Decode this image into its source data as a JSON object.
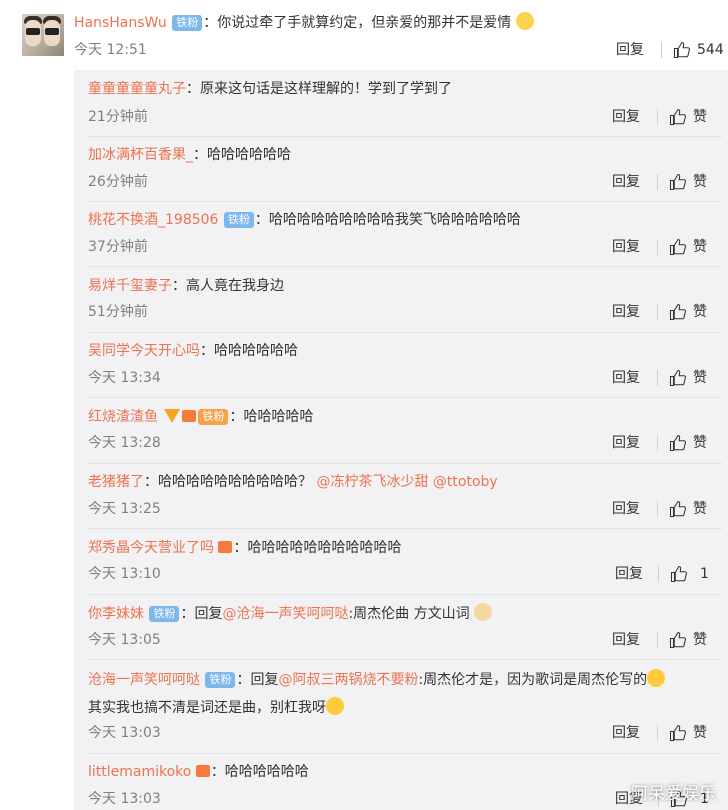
{
  "main_comment": {
    "user": "HansHansWu",
    "badge": "铁粉",
    "colon": "：",
    "text": "你说过牵了手就算约定，但亲爱的那并不是爱情",
    "time": "今天 12:51",
    "reply_label": "回复",
    "like_count": "544"
  },
  "replies": [
    {
      "user": "童童童童童丸子",
      "badge": "",
      "prefix": "",
      "mention": "",
      "text": "：原来这句话是这样理解的！学到了学到了",
      "time": "21分钟前",
      "reply_label": "回复",
      "like_label": "赞"
    },
    {
      "user": "加冰满杯百香果_",
      "badge": "",
      "text": "：哈哈哈哈哈哈",
      "time": "26分钟前",
      "reply_label": "回复",
      "like_label": "赞"
    },
    {
      "user": "桃花不换酒_198506",
      "badge": "铁粉",
      "text": "：哈哈哈哈哈哈哈哈哈我笑飞哈哈哈哈哈哈",
      "time": "37分钟前",
      "reply_label": "回复",
      "like_label": "赞"
    },
    {
      "user": "易烊千玺妻子",
      "badge": "",
      "text": "：高人竟在我身边",
      "time": "51分钟前",
      "reply_label": "回复",
      "like_label": "赞"
    },
    {
      "user": "吴同学今天开心吗",
      "badge": "",
      "text": "：哈哈哈哈哈哈",
      "time": "今天 13:34",
      "reply_label": "回复",
      "like_label": "赞"
    },
    {
      "user": "红烧渣渣鱼",
      "badge": "铁粉",
      "text": "：哈哈哈哈哈",
      "time": "今天 13:28",
      "reply_label": "回复",
      "like_label": "赞"
    },
    {
      "user": "老猪猪了",
      "badge": "",
      "text": "：哈哈哈哈哈哈哈哈哈哈？",
      "mention1": "@冻柠茶飞冰少甜",
      "mention2": "@ttotoby",
      "time": "今天 13:25",
      "reply_label": "回复",
      "like_label": "赞"
    },
    {
      "user": "郑秀晶今天营业了吗",
      "badge": "",
      "text": "：哈哈哈哈哈哈哈哈哈哈哈",
      "time": "今天 13:10",
      "reply_label": "回复",
      "like_count": "1"
    },
    {
      "user": "你李妹妹",
      "badge": "铁粉",
      "text_pre": "：回复",
      "mention": "@沧海一声笑呵呵哒",
      "text": ":周杰伦曲 方文山词",
      "time": "今天 13:05",
      "reply_label": "回复",
      "like_label": "赞"
    },
    {
      "user": "沧海一声笑呵呵哒",
      "badge": "铁粉",
      "text_pre": "：回复",
      "mention": "@阿叔三两锅烧不要粉",
      "text": ":周杰伦才是，因为歌词是周杰伦写的",
      "text_line2": "其实我也搞不清是词还是曲，别杠我呀",
      "time": "今天 13:03",
      "reply_label": "回复",
      "like_label": "赞"
    },
    {
      "user": "littlemamikoko",
      "badge": "",
      "text": "：哈哈哈哈哈哈",
      "time": "今天 13:03",
      "reply_label": "回复",
      "like_count": "1"
    }
  ],
  "watermark": "阿呆爱娱乐",
  "colors": {
    "username": "#eb7350",
    "badge_blue": "#7eb7ec",
    "reply_bg": "#f2f2f5",
    "time_gray": "#808080"
  },
  "icons": [
    "thumbs-up-icon",
    "emoji-icon",
    "vip-v-icon",
    "crown-badge-icon"
  ]
}
